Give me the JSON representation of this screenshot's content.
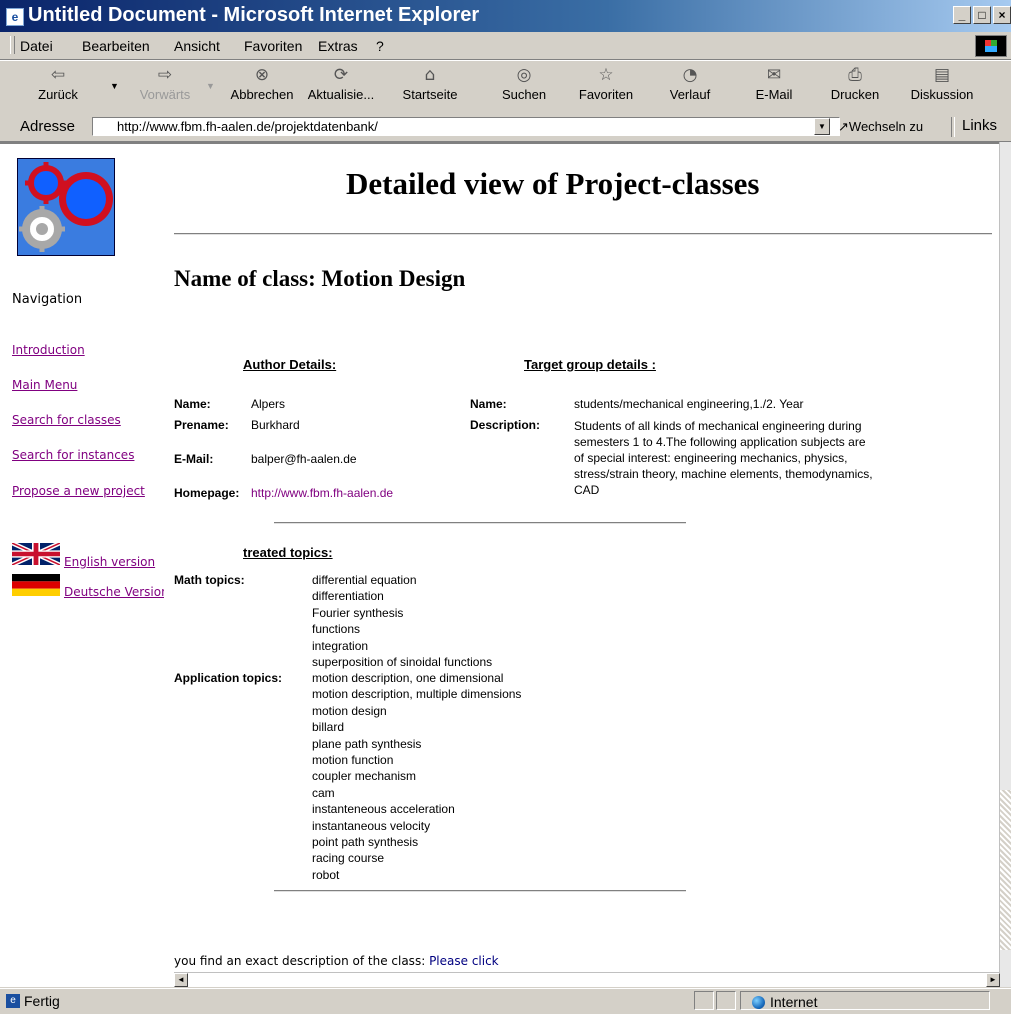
{
  "window": {
    "title": "Untitled Document - Microsoft Internet Explorer",
    "app_icon": "ie-icon",
    "controls": [
      "_",
      "□",
      "×"
    ]
  },
  "menu": {
    "items": [
      "Datei",
      "Bearbeiten",
      "Ansicht",
      "Favoriten",
      "Extras",
      "?"
    ]
  },
  "toolbar": {
    "buttons": [
      {
        "label": "Zurück",
        "icon": "back-arrow-icon",
        "glyph": "⇦"
      },
      {
        "label": "Vorwärts",
        "icon": "forward-arrow-icon",
        "glyph": "⇨"
      },
      {
        "label": "Abbrechen",
        "icon": "stop-icon",
        "glyph": "⊗"
      },
      {
        "label": "Aktualisie...",
        "icon": "refresh-icon",
        "glyph": "⟳"
      },
      {
        "label": "Startseite",
        "icon": "home-icon",
        "glyph": "⌂"
      },
      {
        "label": "Suchen",
        "icon": "search-icon",
        "glyph": "◎"
      },
      {
        "label": "Favoriten",
        "icon": "favorites-icon",
        "glyph": "☆"
      },
      {
        "label": "Verlauf",
        "icon": "history-icon",
        "glyph": "◔"
      },
      {
        "label": "E-Mail",
        "icon": "mail-icon",
        "glyph": "✉"
      },
      {
        "label": "Drucken",
        "icon": "print-icon",
        "glyph": "⎙"
      },
      {
        "label": "Diskussion",
        "icon": "discussion-icon",
        "glyph": "▤"
      }
    ]
  },
  "address": {
    "label": "Adresse",
    "url": "http://www.fbm.fh-aalen.de/projektdatenbank/",
    "go_label": "Wechseln zu",
    "links_label": "Links"
  },
  "nav": {
    "title": "Navigation",
    "links": [
      "Introduction",
      "Main Menu",
      "Search for classes",
      "Search for instances",
      "Propose a new project"
    ],
    "lang": {
      "english": "English version",
      "german": "Deutsche Version"
    }
  },
  "page": {
    "title": "Detailed view of Project-classes",
    "class_title": "Name of class: Motion Design",
    "author": {
      "heading": "Author Details:",
      "name_label": "Name:",
      "name": "Alpers",
      "prename_label": "Prename:",
      "prename": "Burkhard",
      "email_label": "E-Mail:",
      "email": "balper@fh-aalen.de",
      "homepage_label": "Homepage:",
      "homepage": "http://www.fbm.fh-aalen.de"
    },
    "target": {
      "heading": "Target group details :",
      "name_label": "Name:",
      "name": "students/mechanical engineering,1./2. Year",
      "description_label": "Description:",
      "description": "Students of all kinds of mechanical engineering during semesters 1 to 4.The following application subjects are of special interest: engineering mechanics, physics, stress/strain theory, machine elements, themodynamics, CAD"
    },
    "topics": {
      "heading": "treated topics:",
      "math_label": "Math topics:",
      "math": [
        "differential equation",
        "differentiation",
        "Fourier synthesis",
        "functions",
        "integration",
        "superposition of sinoidal functions"
      ],
      "application_label": "Application topics:",
      "application": [
        "motion description, one dimensional",
        "motion description, multiple dimensions",
        "motion design",
        "billard",
        "plane path synthesis",
        "motion function",
        "coupler mechanism",
        "cam",
        "instanteneous acceleration",
        "instantaneous velocity",
        "point path synthesis",
        "racing course",
        "robot"
      ]
    },
    "footer": {
      "text": "you find an exact description of the class:",
      "link": "Please click"
    }
  },
  "status": {
    "text": "Fertig",
    "zone": "Internet"
  },
  "colors": {
    "visited_link": "#800080",
    "link": "#000080",
    "titlebar_start": "#0a246a",
    "gear_red": "#d01020",
    "gear_blue": "#1060ff",
    "gear_gray": "#a8a8a8"
  }
}
